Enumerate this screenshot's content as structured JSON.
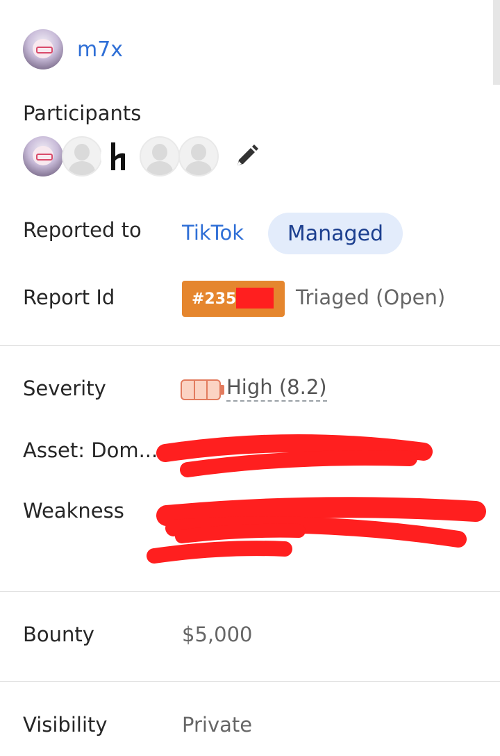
{
  "author": {
    "name": "m7x"
  },
  "participants": {
    "label": "Participants",
    "avatars": [
      "user-avatar",
      "blank-avatar",
      "hackerone-logo",
      "blank-avatar",
      "blank-avatar"
    ]
  },
  "reported_to": {
    "label": "Reported to",
    "program": "TikTok",
    "badge": "Managed"
  },
  "report_id": {
    "label": "Report Id",
    "id_prefix": "#235",
    "status": "Triaged (Open)"
  },
  "severity": {
    "label": "Severity",
    "value": "High (8.2)",
    "level_filled_segments": 3,
    "level_total_segments": 3
  },
  "asset": {
    "label": "Asset: Dom..."
  },
  "weakness": {
    "label": "Weakness"
  },
  "bounty": {
    "label": "Bounty",
    "value": "$5,000"
  },
  "visibility": {
    "label": "Visibility",
    "value": "Private"
  },
  "colors": {
    "link": "#2f6fd6",
    "report_badge": "#e5862e",
    "managed_badge_bg": "#e3ecfb",
    "redaction": "#ff1f1f",
    "severity_high": "#e27b5e"
  }
}
